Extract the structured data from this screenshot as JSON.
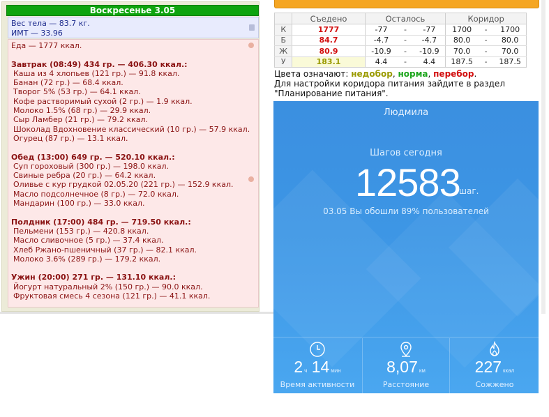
{
  "diary": {
    "day": "Воскресенье 3.05",
    "weight": "Вес тела — 83.7 кг.",
    "bmi": "ИМТ — 33.96",
    "food_total": "Еда — 1777 ккал.",
    "meals": [
      {
        "title": "Завтрак (08:49) 434 гр. — 406.30 ккал.:",
        "items": [
          "Каша из 4 хлопьев (121 гр.) — 91.8 ккал.",
          "Банан (72 гр.) — 68.4 ккал.",
          "Творог 5% (53 гр.) — 64.1 ккал.",
          "Кофе растворимый сухой (2 гр.) — 1.9 ккал.",
          "Молоко 1.5% (68 гр.) — 29.9 ккал.",
          "Сыр Ламбер (21 гр.) — 79.2 ккал.",
          "Шоколад Вдохновение классический (10 гр.) — 57.9 ккал.",
          "Огурец (87 гр.) — 13.1 ккал."
        ]
      },
      {
        "title": "Обед (13:00) 649 гр. — 520.10 ккал.:",
        "items": [
          "Суп гороховый (300 гр.) — 198.0 ккал.",
          "Свиные ребра (20 гр.) — 64.2 ккал.",
          "Оливье с кур грудкой 02.05.20 (221 гр.) — 152.9 ккал.",
          "Масло подсолнечное (8 гр.) — 72.0 ккал.",
          "Мандарин (100 гр.) — 33.0 ккал."
        ]
      },
      {
        "title": "Полдник (17:00) 484 гр. — 719.50 ккал.:",
        "items": [
          "Пельмени (153 гр.) — 420.8 ккал.",
          "Масло сливочное (5 гр.) — 37.4 ккал.",
          "Хлеб Ржано-пшеничный (37 гр.) — 82.1 ккал.",
          "Молоко 3.6% (289 гр.) — 179.2 ккал."
        ]
      },
      {
        "title": "Ужин (20:00) 271 гр. — 131.10 ккал.:",
        "items": [
          "Йогурт натуральный 2% (150 гр.) — 90.0 ккал.",
          "Фруктовая смесь 4 сезона (121 гр.) — 41.1 ккал."
        ]
      }
    ]
  },
  "nutrition": {
    "headers": {
      "eaten": "Съедено",
      "left": "Осталось",
      "corridor": "Коридор"
    },
    "rows": [
      {
        "label": "К",
        "eaten": "1777",
        "eaten_color": "#d20f0f",
        "left_a": "-77",
        "dash1": "-",
        "left_b": "-77",
        "cor_a": "1700",
        "dash2": "-",
        "cor_b": "1700"
      },
      {
        "label": "Б",
        "eaten": "84.7",
        "eaten_color": "#d20f0f",
        "left_a": "-4.7",
        "dash1": "-",
        "left_b": "-4.7",
        "cor_a": "80.0",
        "dash2": "-",
        "cor_b": "80.0"
      },
      {
        "label": "Ж",
        "eaten": "80.9",
        "eaten_color": "#d20f0f",
        "left_a": "-10.9",
        "dash1": "-",
        "left_b": "-10.9",
        "cor_a": "70.0",
        "dash2": "-",
        "cor_b": "70.0"
      },
      {
        "label": "У",
        "eaten": "183.1",
        "eaten_color": "#9a9a00",
        "left_a": "4.4",
        "dash1": "-",
        "left_b": "4.4",
        "cor_a": "187.5",
        "dash2": "-",
        "cor_b": "187.5"
      }
    ],
    "legend_prefix": "Цвета означают: ",
    "legend_under": "недобор",
    "legend_norm": "норма",
    "legend_over": "перебор",
    "comma": ", ",
    "period": ".",
    "hint": "Для настройки коридора питания зайдите в раздел \"Планирование питания\"."
  },
  "phone": {
    "user": "Людмила",
    "steps_label": "Шагов сегодня",
    "steps": "12583",
    "steps_unit": "шаг.",
    "steps_sub": "03.05 Вы обошли 89% пользователей",
    "stats": [
      {
        "icon": "clock-icon",
        "value_a": "2",
        "unit_a": "ч",
        "value_b": "14",
        "unit_b": "мин",
        "caption": "Время активности"
      },
      {
        "icon": "location-pin-icon",
        "value_a": "8,07",
        "unit_a": "км",
        "caption": "Расстояние"
      },
      {
        "icon": "flame-icon",
        "value_a": "227",
        "unit_a": "ккал",
        "caption": "Сожжено"
      }
    ]
  }
}
